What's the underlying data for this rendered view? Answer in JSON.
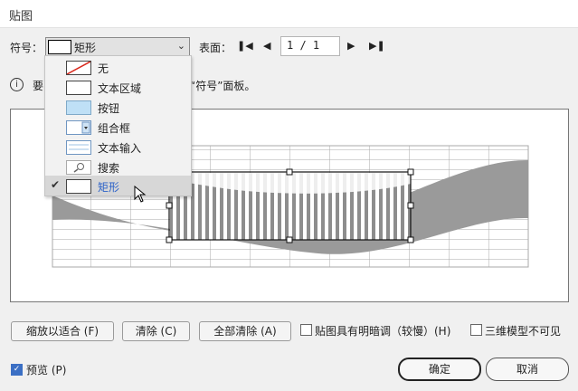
{
  "window": {
    "title": "贴图"
  },
  "toolbar": {
    "symbol_label": "符号：",
    "symbol_selected": "矩形",
    "surface_label": "表面：",
    "page_value": "1 / 1"
  },
  "info": {
    "text_part1": "要",
    "text_part2": "“符号”面板。"
  },
  "dropdown": {
    "items": [
      {
        "label": "无",
        "icon": "none-swatch-icon"
      },
      {
        "label": "文本区域",
        "icon": "text-area-icon"
      },
      {
        "label": "按钮",
        "icon": "button-icon"
      },
      {
        "label": "组合框",
        "icon": "combo-box-icon"
      },
      {
        "label": "文本输入",
        "icon": "text-input-icon"
      },
      {
        "label": "搜索",
        "icon": "search-icon"
      },
      {
        "label": "矩形",
        "icon": "rectangle-icon",
        "selected": true
      }
    ]
  },
  "buttons": {
    "fit": "缩放以适合 (F)",
    "clear": "清除 (C)",
    "clear_all": "全部清除 (A)",
    "ok": "确定",
    "cancel": "取消"
  },
  "checkboxes": {
    "shade": {
      "label": "贴图具有明暗调（较慢）(H)",
      "checked": false
    },
    "invisible": {
      "label": "三维模型不可见",
      "checked": false
    },
    "preview": {
      "label": "预览 (P)",
      "checked": true
    }
  },
  "colors": {
    "accent": "#3b6fc4",
    "selected_text": "#2d63c8"
  }
}
